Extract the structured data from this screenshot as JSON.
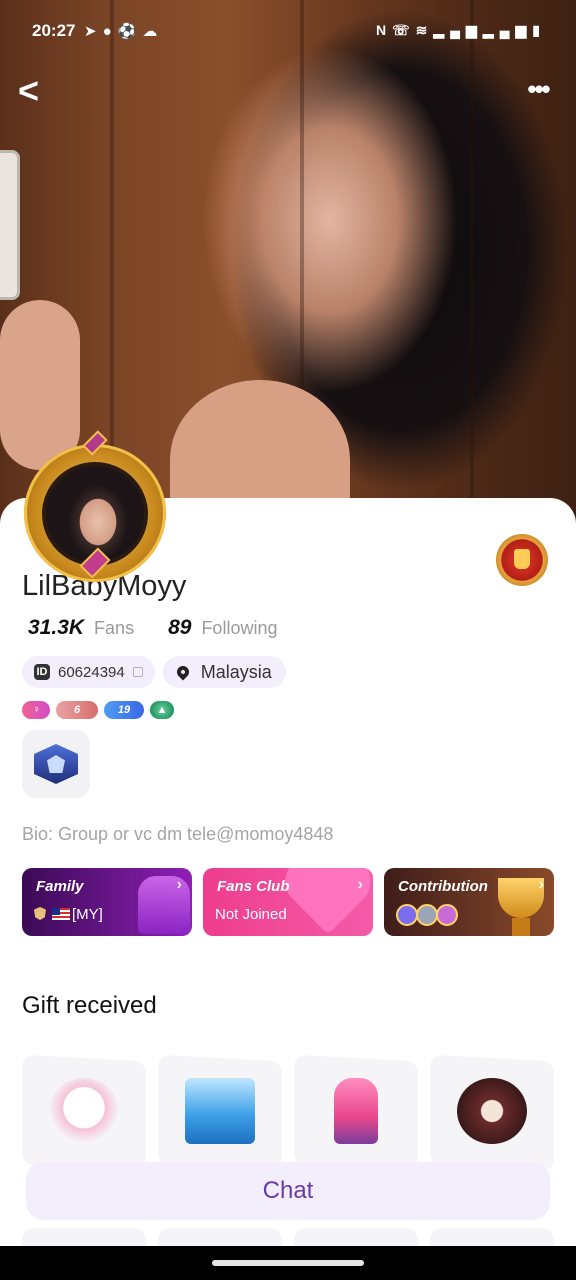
{
  "status_bar": {
    "time": "20:27",
    "left_icons": [
      "telegram-icon",
      "chat-icon",
      "soccer-icon",
      "cloud-icon"
    ],
    "right_icons": [
      "nfc-icon",
      "wifi-call-icon",
      "wifi-icon",
      "signal-icon",
      "signal-icon",
      "battery-icon"
    ]
  },
  "nav": {
    "back_label": "<",
    "more_label": "•••"
  },
  "profile": {
    "username": "LilBabyMoyy",
    "fans_count": "31.3K",
    "fans_label": "Fans",
    "following_count": "89",
    "following_label": "Following",
    "user_id": "60624394",
    "location": "Malaysia",
    "levels": {
      "gender": "♀",
      "wealth": "6",
      "star": "19",
      "green": "▲"
    },
    "bio": "Bio: Group or vc dm tele@momoy4848"
  },
  "cards": {
    "family": {
      "title": "Family",
      "value": "[MY]"
    },
    "fans_club": {
      "title": "Fans Club",
      "value": "Not Joined"
    },
    "contribution": {
      "title": "Contribution",
      "ranks": [
        "1",
        "2",
        "3"
      ]
    }
  },
  "gifts": {
    "section_title": "Gift received",
    "items": [
      "bear",
      "yacht",
      "candy-machine",
      "lantern"
    ]
  },
  "chat": {
    "label": "Chat"
  },
  "colors": {
    "accent": "#6b3aa5",
    "chip_bg": "#f3eefb",
    "family_card": "#3b0a55",
    "fans_card": "#ee3d8d",
    "contribution_card": "#3f1d1a"
  }
}
